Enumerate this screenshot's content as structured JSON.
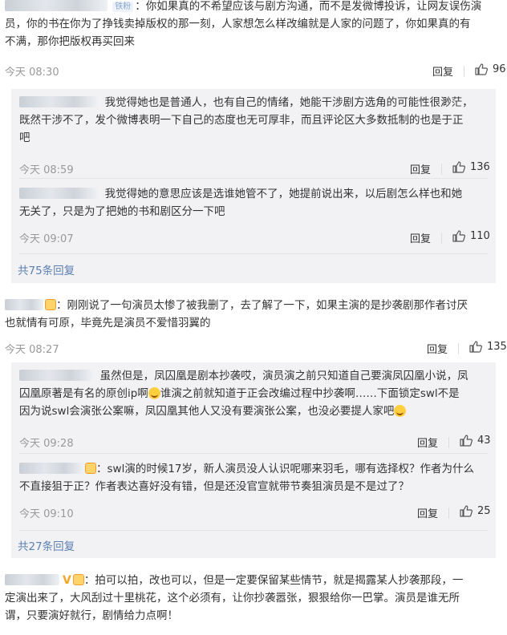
{
  "comments": [
    {
      "tag": "铁粉",
      "text_lines": [
        "你如果真的不希望应该与剧方沟通，而不是发微博投诉，让网友误伤演",
        "员，你的书在你为了挣钱卖掉版权的那一刻，人家想怎么样改编就是人家的问题了，你如果真的有",
        "不满，那你把版权再买回来"
      ],
      "time": "今天 08:30",
      "reply_label": "回复",
      "likes": "96",
      "replies": [
        {
          "text_lines": [
            "我觉得她也是普通人，也有自己的情绪，她能干涉剧方选角的可能性很渺茫，",
            "既然干涉不了，发个微博表明一下自己的态度也无可厚非，而且评论区大多数抵制的也是于正",
            "吧"
          ],
          "time": "今天 08:59",
          "reply_label": "回复",
          "likes": "136"
        },
        {
          "text_lines": [
            "我觉得她的意思应该是选谁她管不了，她提前说出来，以后剧怎么样也和她",
            "无关了，只是为了把她的书和剧区分一下吧"
          ],
          "time": "今天 09:07",
          "reply_label": "回复",
          "likes": "110"
        }
      ],
      "more_replies": "共75条回复"
    },
    {
      "text_lines": [
        "刚刚说了一句演员太惨了被我删了，去了解了一下，如果主演的是抄袭剧那作者讨厌",
        "也就情有可原，毕竟先是演员不爱惜羽翼的"
      ],
      "time": "今天 08:27",
      "reply_label": "回复",
      "likes": "135",
      "replies": [
        {
          "text_lines": [
            "虽然但是，凤囚凰是剧本抄袭哎，演员演之前只知道自己要演凤囚凰小说，凤",
            "囚凰原著是有名的原创ip啊",
            "谁演之前就知道于正会改编过程中抄袭啊……下面锁定swl不是",
            "因为说swl会演张公案嘛，凤囚凰其他人又没有要演张公案，也没必要提人家吧"
          ],
          "time": "今天 09:28",
          "reply_label": "回复",
          "likes": "43"
        },
        {
          "text_lines": [
            "swl演的时候17岁，新人演员没人认识呢哪来羽毛，哪有选择权？作者为什么",
            "不直接狙于正？作者表达喜好没有错，但是还没官宣就带节奏狙演员是不是过了？"
          ],
          "time": "今天 09:10",
          "reply_label": "回复",
          "likes": "25"
        }
      ],
      "more_replies": "共27条回复"
    },
    {
      "text_lines": [
        "拍可以拍，改也可以，但是一定要保留某些情节，就是揭露某人抄袭那段，一",
        "定演出来了，大风刮过十里桃花，这个必须有，让你抄袭嚣张，狠狠给你一巴掌。演员是谁无所",
        "谓，只要演好就行，剧情给力点啊！"
      ],
      "badge": "V"
    }
  ]
}
